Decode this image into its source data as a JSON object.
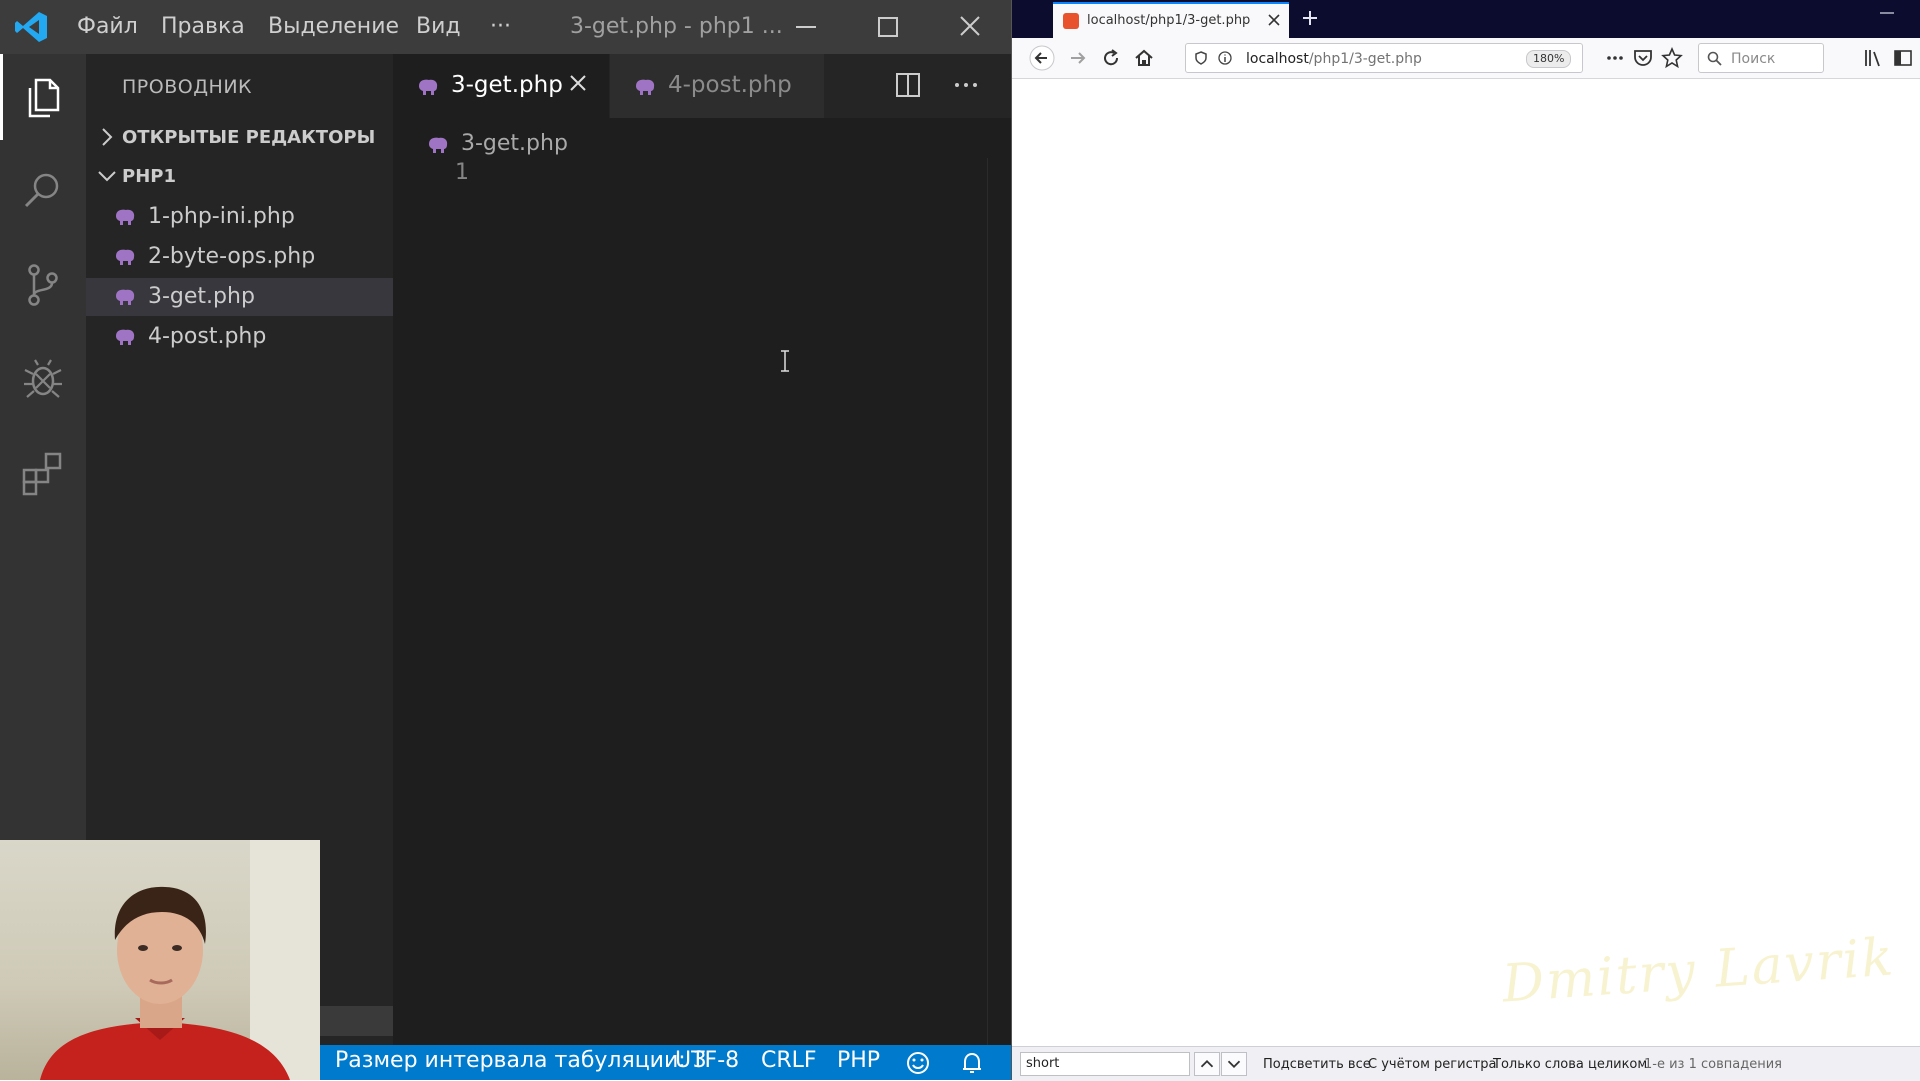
{
  "vscode": {
    "menu": [
      "Файл",
      "Правка",
      "Выделение",
      "Вид",
      "···"
    ],
    "window_title": "3-get.php - php1 ...",
    "sidebar": {
      "title": "ПРОВОДНИК",
      "open_editors_label": "ОТКРЫТЫЕ РЕДАКТОРЫ",
      "folder_label": "PHP1",
      "files": [
        "1-php-ini.php",
        "2-byte-ops.php",
        "3-get.php",
        "4-post.php"
      ],
      "selected_file": "3-get.php"
    },
    "tabs": [
      {
        "label": "3-get.php",
        "active": true
      },
      {
        "label": "4-post.php",
        "active": false
      }
    ],
    "breadcrumb": "3-get.php",
    "line_numbers": [
      "1"
    ],
    "statusbar": {
      "indent": "Размер интервала табуляции: 3",
      "encoding": "UTF-8",
      "eol": "CRLF",
      "language": "PHP"
    },
    "colors": {
      "accent": "#007acc",
      "php_icon": "#a074c4",
      "logo": "#23a9f2"
    }
  },
  "firefox": {
    "tab_title": "localhost/php1/3-get.php",
    "url_host": "localhost",
    "url_path": "/php1/3-get.php",
    "zoom": "180%",
    "search_placeholder": "Поиск",
    "watermark": "Dmitry Lavrik",
    "findbar": {
      "query": "short",
      "highlight_all": "Подсветить все",
      "match_case": "С учётом регистра",
      "whole_words": "Только слова целиком",
      "result": "1-е из 1 совпадения"
    }
  }
}
